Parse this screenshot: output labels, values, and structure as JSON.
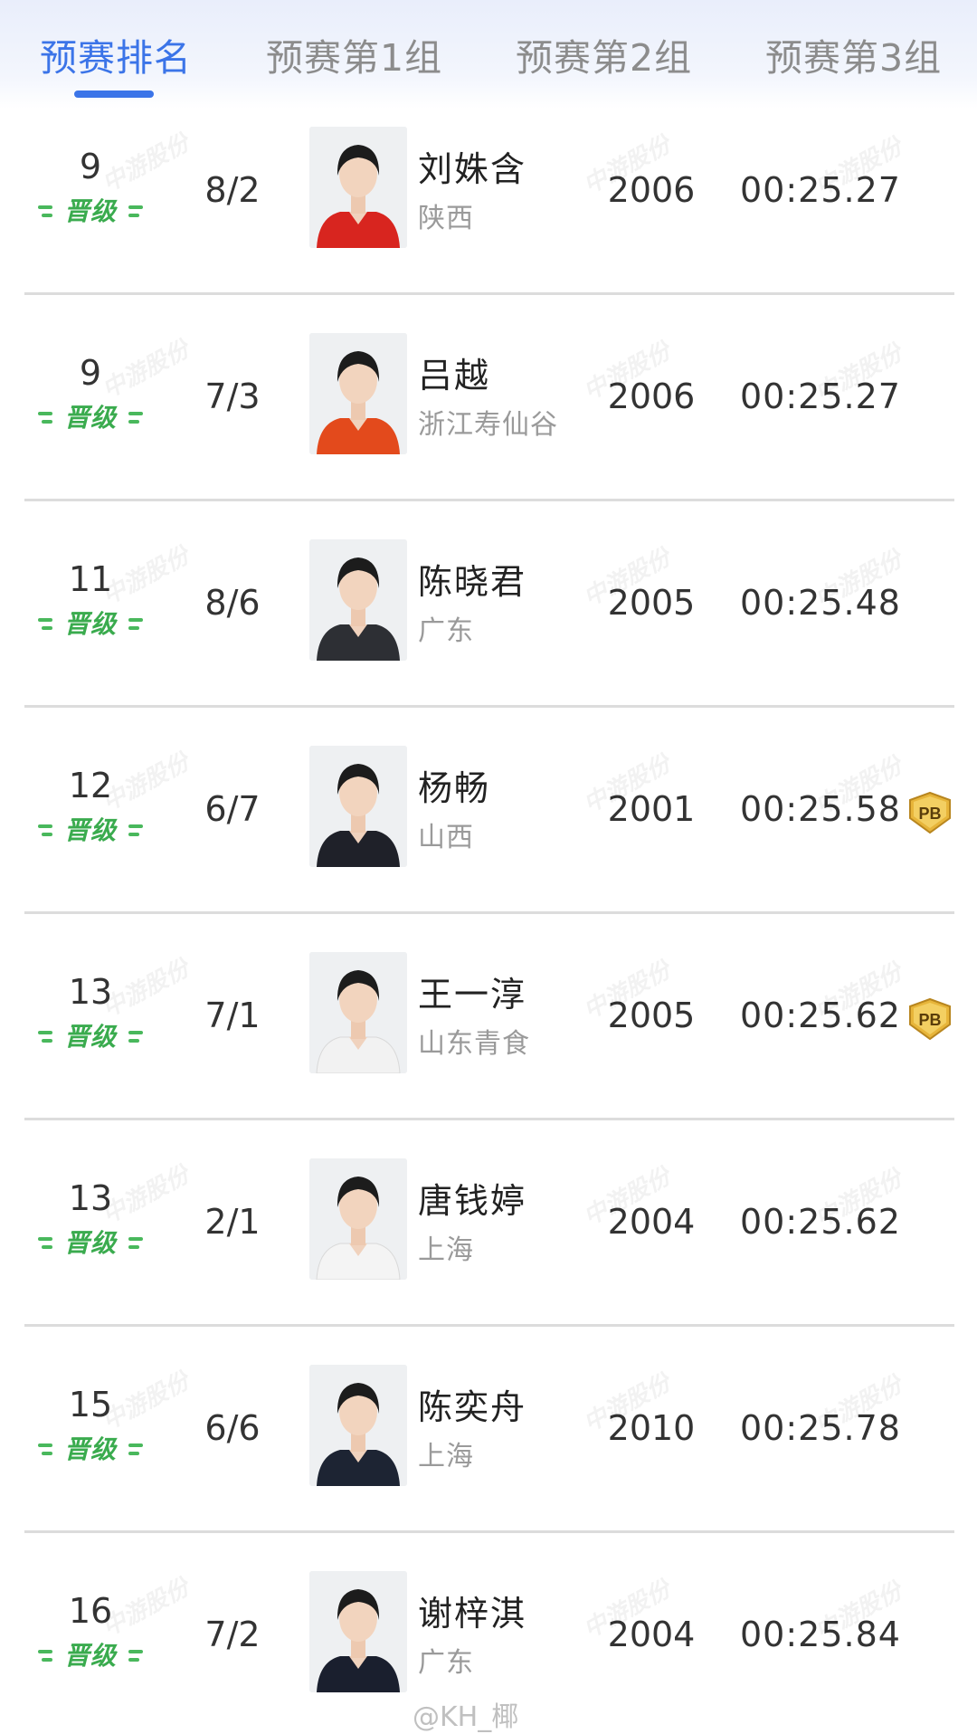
{
  "tabs": [
    {
      "label": "预赛排名",
      "active": true
    },
    {
      "label": "预赛第1组",
      "active": false
    },
    {
      "label": "预赛第2组",
      "active": false
    },
    {
      "label": "预赛第3组",
      "active": false
    }
  ],
  "qualify_label": "晋级",
  "pb_label": "PB",
  "colors": {
    "accent": "#3b74e8",
    "qualify": "#3aab4e",
    "pb_gold": "#d9a92a"
  },
  "rows": [
    {
      "rank": "9",
      "lane": "8/2",
      "name": "刘姝含",
      "team": "陕西",
      "year": "2006",
      "time": "00:25.27",
      "pb": false,
      "jacket": "#d8251f"
    },
    {
      "rank": "9",
      "lane": "7/3",
      "name": "吕越",
      "team": "浙江寿仙谷",
      "year": "2006",
      "time": "00:25.27",
      "pb": false,
      "jacket": "#e34a1c"
    },
    {
      "rank": "11",
      "lane": "8/6",
      "name": "陈晓君",
      "team": "广东",
      "year": "2005",
      "time": "00:25.48",
      "pb": false,
      "jacket": "#2d2f34"
    },
    {
      "rank": "12",
      "lane": "6/7",
      "name": "杨畅",
      "team": "山西",
      "year": "2001",
      "time": "00:25.58",
      "pb": true,
      "jacket": "#1f2129"
    },
    {
      "rank": "13",
      "lane": "7/1",
      "name": "王一淳",
      "team": "山东青食",
      "year": "2005",
      "time": "00:25.62",
      "pb": true,
      "jacket": "#f2f2f2"
    },
    {
      "rank": "13",
      "lane": "2/1",
      "name": "唐钱婷",
      "team": "上海",
      "year": "2004",
      "time": "00:25.62",
      "pb": false,
      "jacket": "#f4f4f4"
    },
    {
      "rank": "15",
      "lane": "6/6",
      "name": "陈奕舟",
      "team": "上海",
      "year": "2010",
      "time": "00:25.78",
      "pb": false,
      "jacket": "#1d2433"
    },
    {
      "rank": "16",
      "lane": "7/2",
      "name": "谢梓淇",
      "team": "广东",
      "year": "2004",
      "time": "00:25.84",
      "pb": false,
      "jacket": "#1a1f2e"
    }
  ],
  "watermark": "中游股份",
  "footer": {
    "weibo_handle": "@KH_椰"
  }
}
